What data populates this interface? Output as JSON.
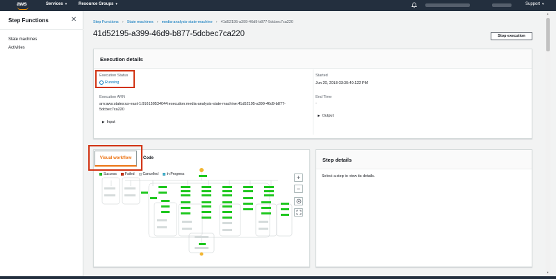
{
  "nav": {
    "logo": "aws",
    "services": "Services",
    "resource_groups": "Resource Groups",
    "support": "Support"
  },
  "sidebar": {
    "title": "Step Functions",
    "items": [
      {
        "label": "State machines"
      },
      {
        "label": "Activities"
      }
    ]
  },
  "breadcrumb": {
    "items": [
      "Step Functions",
      "State machines",
      "media-analysis-state-machine"
    ],
    "current": "41d52195-a399-46d9-b877-5dcbec7ca220"
  },
  "page": {
    "title": "41d52195-a399-46d9-b877-5dcbec7ca220",
    "stop_button": "Stop execution"
  },
  "execution_details": {
    "title": "Execution details",
    "status_label": "Execution Status",
    "status_value": "Running",
    "arn_label": "Execution ARN",
    "arn_value_line1": "arn:aws:states:us-east-1:916150534044:execution:media-analysis-state-machine:41d52195-a399-46d9-b877-",
    "arn_value_line2": "5dcbec7ca220",
    "input_label": "Input",
    "started_label": "Started",
    "started_value": "Jun 20, 2018 03:39:40.122 PM",
    "end_label": "End Time",
    "end_value": "-",
    "output_label": "Output"
  },
  "workflow": {
    "tab_visual": "Visual workflow",
    "tab_code": "Code",
    "legend": [
      {
        "label": "Success",
        "color": "#1ec71e"
      },
      {
        "label": "Failed",
        "color": "#d13212"
      },
      {
        "label": "Cancelled",
        "color": "#d5dbdb"
      },
      {
        "label": "In Progress",
        "color": "#44b9d6"
      }
    ],
    "zoom_in": "+",
    "zoom_out": "−"
  },
  "step_details": {
    "title": "Step details",
    "message": "Select a step to view its details."
  },
  "colors": {
    "accent": "#ec7211",
    "link": "#0073bb",
    "highlight": "#d13212",
    "navbar": "#232f3e"
  }
}
